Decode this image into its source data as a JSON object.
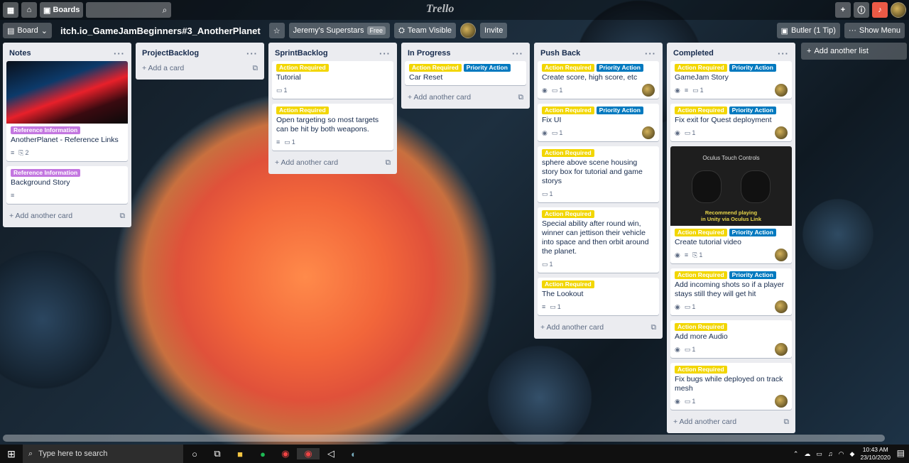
{
  "topbar": {
    "boards_label": "Boards",
    "logo": "Trello"
  },
  "boardbar": {
    "board_btn": "Board",
    "title": "itch.io_GameJamBeginners#3_AnotherPlanet",
    "team": "Jeremy's Superstars",
    "free": "Free",
    "visibility": "Team Visible",
    "invite": "Invite",
    "butler": "Butler (1 Tip)",
    "show_menu": "Show Menu"
  },
  "lists": [
    {
      "title": "Notes",
      "add": "Add another card",
      "cards": [
        {
          "cover": "image",
          "labels": [
            {
              "t": "Reference Information",
              "c": "lp"
            }
          ],
          "title": "AnotherPlanet - Reference Links",
          "desc": true,
          "attach": "2"
        },
        {
          "labels": [
            {
              "t": "Reference Information",
              "c": "lp"
            }
          ],
          "title": "Background Story",
          "desc": true
        }
      ]
    },
    {
      "title": "ProjectBacklog",
      "add": "Add a card",
      "cards": []
    },
    {
      "title": "SprintBacklog",
      "add": "Add another card",
      "cards": [
        {
          "labels": [
            {
              "t": "Action Required",
              "c": "ly"
            }
          ],
          "title": "Tutorial",
          "comments": "1"
        },
        {
          "labels": [
            {
              "t": "Action Required",
              "c": "ly"
            }
          ],
          "title": "Open targeting so most targets can be hit by both weapons.",
          "desc": true,
          "comments": "1"
        }
      ]
    },
    {
      "title": "In Progress",
      "add": "Add another card",
      "cards": [
        {
          "labels": [
            {
              "t": "Action Required",
              "c": "ly"
            },
            {
              "t": "Priority Action",
              "c": "lb"
            }
          ],
          "title": "Car Reset"
        }
      ]
    },
    {
      "title": "Push Back",
      "add": "Add another card",
      "cards": [
        {
          "labels": [
            {
              "t": "Action Required",
              "c": "ly"
            },
            {
              "t": "Priority Action",
              "c": "lb"
            }
          ],
          "title": "Create score, high score, etc",
          "watch": true,
          "comments": "1",
          "member": true
        },
        {
          "labels": [
            {
              "t": "Action Required",
              "c": "ly"
            },
            {
              "t": "Priority Action",
              "c": "lb"
            }
          ],
          "title": "Fix UI",
          "watch": true,
          "comments": "1",
          "member": true
        },
        {
          "labels": [
            {
              "t": "Action Required",
              "c": "ly"
            }
          ],
          "title": "sphere above scene housing story box for tutorial and game storys",
          "comments": "1"
        },
        {
          "labels": [
            {
              "t": "Action Required",
              "c": "ly"
            }
          ],
          "title": "Special ability after round win, winner can jettison their vehicle into space and then orbit around the planet.",
          "comments": "1"
        },
        {
          "labels": [
            {
              "t": "Action Required",
              "c": "ly"
            }
          ],
          "title": "The Lookout",
          "desc": true,
          "comments": "1"
        }
      ]
    },
    {
      "title": "Completed",
      "add": "Add another card",
      "cards": [
        {
          "labels": [
            {
              "t": "Action Required",
              "c": "ly"
            },
            {
              "t": "Priority Action",
              "c": "lb"
            }
          ],
          "title": "GameJam Story",
          "watch": true,
          "desc": true,
          "comments": "1",
          "member": true
        },
        {
          "labels": [
            {
              "t": "Action Required",
              "c": "ly"
            },
            {
              "t": "Priority Action",
              "c": "lb"
            }
          ],
          "title": "Fix exit for Quest deployment",
          "watch": true,
          "comments": "1",
          "member": true
        },
        {
          "cover": "oculus",
          "labels": [
            {
              "t": "Action Required",
              "c": "ly"
            },
            {
              "t": "Priority Action",
              "c": "lb"
            }
          ],
          "title": "Create tutorial video",
          "watch": true,
          "desc": true,
          "attach": "1",
          "member": true
        },
        {
          "labels": [
            {
              "t": "Action Required",
              "c": "ly"
            },
            {
              "t": "Priority Action",
              "c": "lb"
            }
          ],
          "title": "Add incoming shots so if a player stays still they will get hit",
          "watch": true,
          "comments": "1",
          "member": true
        },
        {
          "labels": [
            {
              "t": "Action Required",
              "c": "ly"
            }
          ],
          "title": "Add more Audio",
          "watch": true,
          "comments": "1",
          "member": true
        },
        {
          "labels": [
            {
              "t": "Action Required",
              "c": "ly"
            }
          ],
          "title": "Fix bugs while deployed on track mesh",
          "watch": true,
          "comments": "1",
          "member": true
        }
      ]
    }
  ],
  "oculus": {
    "title": "Oculus Touch Controls",
    "caption1": "Recommend playing",
    "caption2": "in Unity via Oculus Link"
  },
  "add_list": "Add another list",
  "taskbar": {
    "search": "Type here to search",
    "time": "10:43 AM",
    "date": "23/10/2020"
  }
}
